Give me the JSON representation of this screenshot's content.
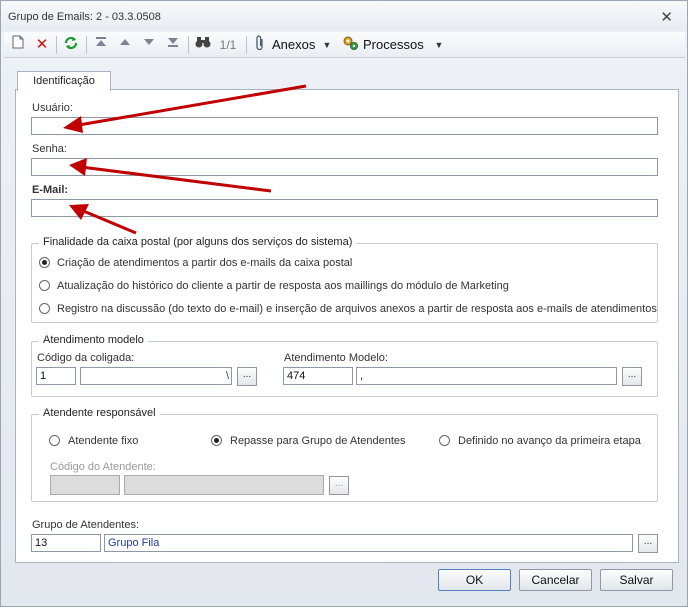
{
  "window": {
    "title": "Grupo de Emails: 2 - 03.3.0508",
    "close_glyph": "✕"
  },
  "toolbar": {
    "page_indicator": "1/1",
    "anexos_label": "Anexos",
    "processos_label": "Processos",
    "icons": [
      "new-icon",
      "delete-icon",
      "refresh-icon",
      "first-icon",
      "previous-icon",
      "next-icon",
      "last-icon",
      "binoculars-icon",
      "paperclip-icon",
      "gears-icon"
    ]
  },
  "tabs": [
    {
      "label": "Identificação"
    }
  ],
  "form": {
    "usuario_label": "Usuário:",
    "usuario_value": "",
    "senha_label": "Senha:",
    "senha_value": "",
    "email_label": "E-Mail:",
    "email_value": ""
  },
  "finalidade": {
    "title": "Finalidade da caixa postal (por alguns dos serviços do sistema)",
    "options": [
      {
        "label": "Criação de atendimentos a partir dos e-mails da caixa postal",
        "checked": true
      },
      {
        "label": "Atualização do histórico do cliente a partir de resposta aos maillings do módulo de Marketing",
        "checked": false
      },
      {
        "label": "Registro na discussão (do texto do e-mail) e inserção de arquivos anexos a partir de resposta aos e-mails de atendimentos",
        "checked": false
      }
    ]
  },
  "atendimento_modelo": {
    "title": "Atendimento modelo",
    "coligada_label": "Código da coligada:",
    "coligada_code": "1",
    "coligada_name": "",
    "coligada_link": "\\",
    "modelo_label": "Atendimento Modelo:",
    "modelo_code": "474",
    "modelo_name": ",",
    "browse": "..."
  },
  "atendente_responsavel": {
    "title": "Atendente responsável",
    "options": [
      {
        "label": "Atendente fixo",
        "checked": false
      },
      {
        "label": "Repasse para Grupo de Atendentes",
        "checked": true
      },
      {
        "label": "Definido no avanço da primeira etapa",
        "checked": false
      }
    ],
    "codigo_label": "Código do Atendente:",
    "codigo_value": "",
    "nome_value": "",
    "browse": "..."
  },
  "grupo_atendentes": {
    "label": "Grupo de Atendentes:",
    "code": "13",
    "name": "Grupo Fila",
    "browse": "..."
  },
  "buttons": {
    "ok": "OK",
    "cancelar": "Cancelar",
    "salvar": "Salvar"
  },
  "colors": {
    "arrow": "#c00000",
    "accent_border": "#4f7fbf",
    "link_text": "#1c3d99"
  }
}
